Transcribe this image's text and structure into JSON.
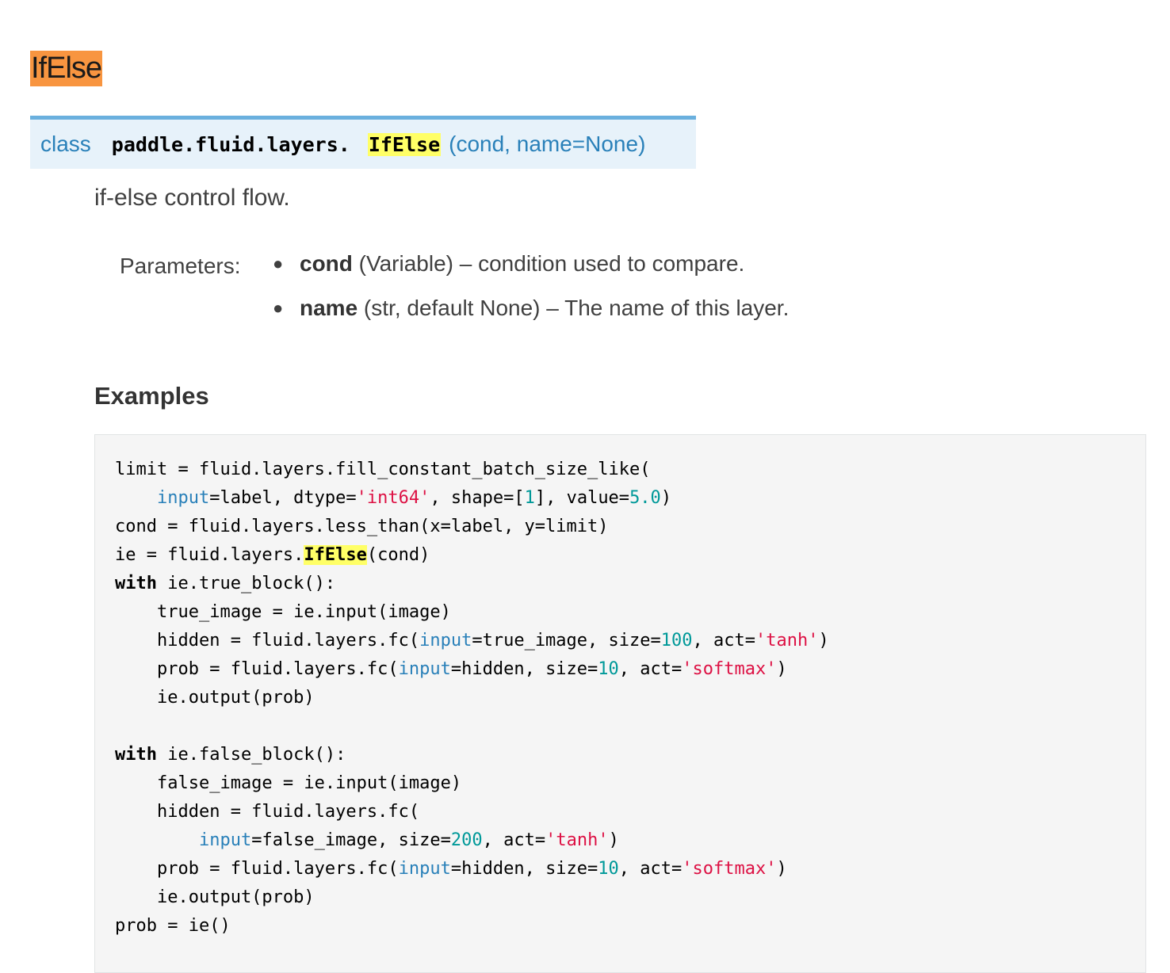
{
  "page_title": "IfElse",
  "signature": {
    "keyword": "class",
    "module_path": "paddle.fluid.layers.",
    "class_name": "IfElse",
    "args": "(cond, name=None)"
  },
  "description": "if-else control flow.",
  "parameters": {
    "label": "Parameters:",
    "items": [
      {
        "name": "cond",
        "detail": " (Variable) – condition used to compare."
      },
      {
        "name": "name",
        "detail": " (str, default None) – The name of this layer."
      }
    ]
  },
  "examples_heading": "Examples",
  "code": {
    "l1": "limit = fluid.layers.fill_constant_batch_size_like(",
    "l2a": "    ",
    "l2_param": "input",
    "l2b": "=label, dtype=",
    "l2_str": "'int64'",
    "l2c": ", shape=[",
    "l2_num1": "1",
    "l2d": "], value=",
    "l2_num2": "5.0",
    "l2e": ")",
    "l3": "cond = fluid.layers.less_than(x=label, y=limit)",
    "l4a": "ie = fluid.layers.",
    "l4_hl": "IfElse",
    "l4b": "(cond)",
    "l5_kw": "with",
    "l5b": " ie.true_block():",
    "l6": "    true_image = ie.input(image)",
    "l7a": "    hidden = fluid.layers.fc(",
    "l7_param": "input",
    "l7b": "=true_image, size=",
    "l7_num": "100",
    "l7c": ", act=",
    "l7_str": "'tanh'",
    "l7d": ")",
    "l8a": "    prob = fluid.layers.fc(",
    "l8_param": "input",
    "l8b": "=hidden, size=",
    "l8_num": "10",
    "l8c": ", act=",
    "l8_str": "'softmax'",
    "l8d": ")",
    "l9": "    ie.output(prob)",
    "l11_kw": "with",
    "l11b": " ie.false_block():",
    "l12": "    false_image = ie.input(image)",
    "l13": "    hidden = fluid.layers.fc(",
    "l14a": "        ",
    "l14_param": "input",
    "l14b": "=false_image, size=",
    "l14_num": "200",
    "l14c": ", act=",
    "l14_str": "'tanh'",
    "l14d": ")",
    "l15a": "    prob = fluid.layers.fc(",
    "l15_param": "input",
    "l15b": "=hidden, size=",
    "l15_num": "10",
    "l15c": ", act=",
    "l15_str": "'softmax'",
    "l15d": ")",
    "l16": "    ie.output(prob)",
    "l17": "prob = ie()"
  }
}
